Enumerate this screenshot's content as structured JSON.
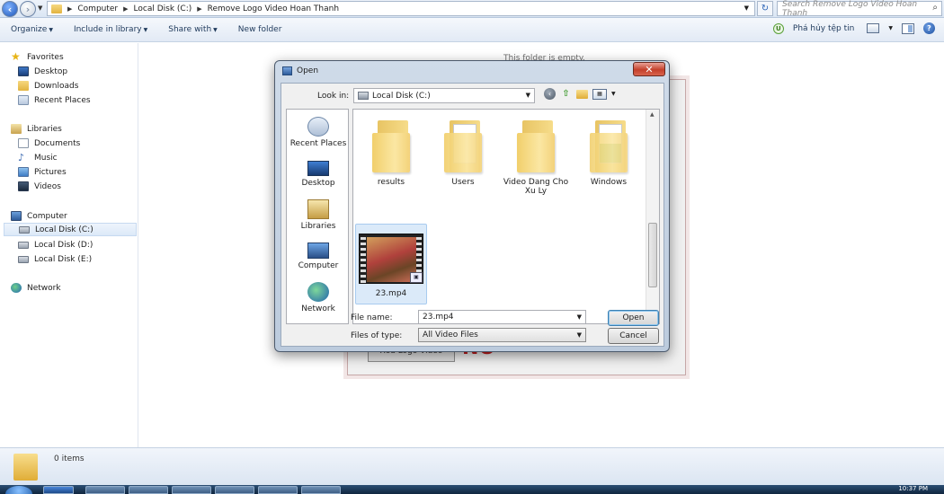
{
  "explorer": {
    "breadcrumb": [
      "Computer",
      "Local Disk (C:)",
      "Remove Logo Video Hoan Thanh"
    ],
    "search_placeholder": "Search Remove Logo Video Hoan Thanh",
    "toolbar": {
      "organize": "Organize",
      "include_in_library": "Include in library",
      "share_with": "Share with",
      "new_folder": "New folder",
      "destroy_files": "Phá hủy tệp tin"
    },
    "nav": {
      "favorites": "Favorites",
      "desktop": "Desktop",
      "downloads": "Downloads",
      "recent_places": "Recent Places",
      "libraries": "Libraries",
      "documents": "Documents",
      "music": "Music",
      "pictures": "Pictures",
      "videos": "Videos",
      "computer": "Computer",
      "disk_c": "Local Disk (C:)",
      "disk_d": "Local Disk (D:)",
      "disk_e": "Local Disk (E:)",
      "network": "Network"
    },
    "empty_message": "This folder is empty.",
    "status": "0 items"
  },
  "background_app": {
    "button_label": "Xoa Logo Video",
    "big_text": "NO"
  },
  "dialog": {
    "title": "Open",
    "look_in_label": "Look in:",
    "look_in_value": "Local Disk (C:)",
    "places": [
      "Recent Places",
      "Desktop",
      "Libraries",
      "Computer",
      "Network"
    ],
    "files": [
      {
        "name": "results",
        "kind": "folder"
      },
      {
        "name": "Users",
        "kind": "folder"
      },
      {
        "name": "Video Dang Cho Xu Ly",
        "kind": "folder"
      },
      {
        "name": "Windows",
        "kind": "folder"
      },
      {
        "name": "23.mp4",
        "kind": "video",
        "selected": true
      }
    ],
    "file_name_label": "File name:",
    "file_name_value": "23.mp4",
    "file_type_label": "Files of type:",
    "file_type_value": "All Video Files",
    "open_button": "Open",
    "cancel_button": "Cancel"
  },
  "taskbar": {
    "clock": "10:37 PM"
  }
}
